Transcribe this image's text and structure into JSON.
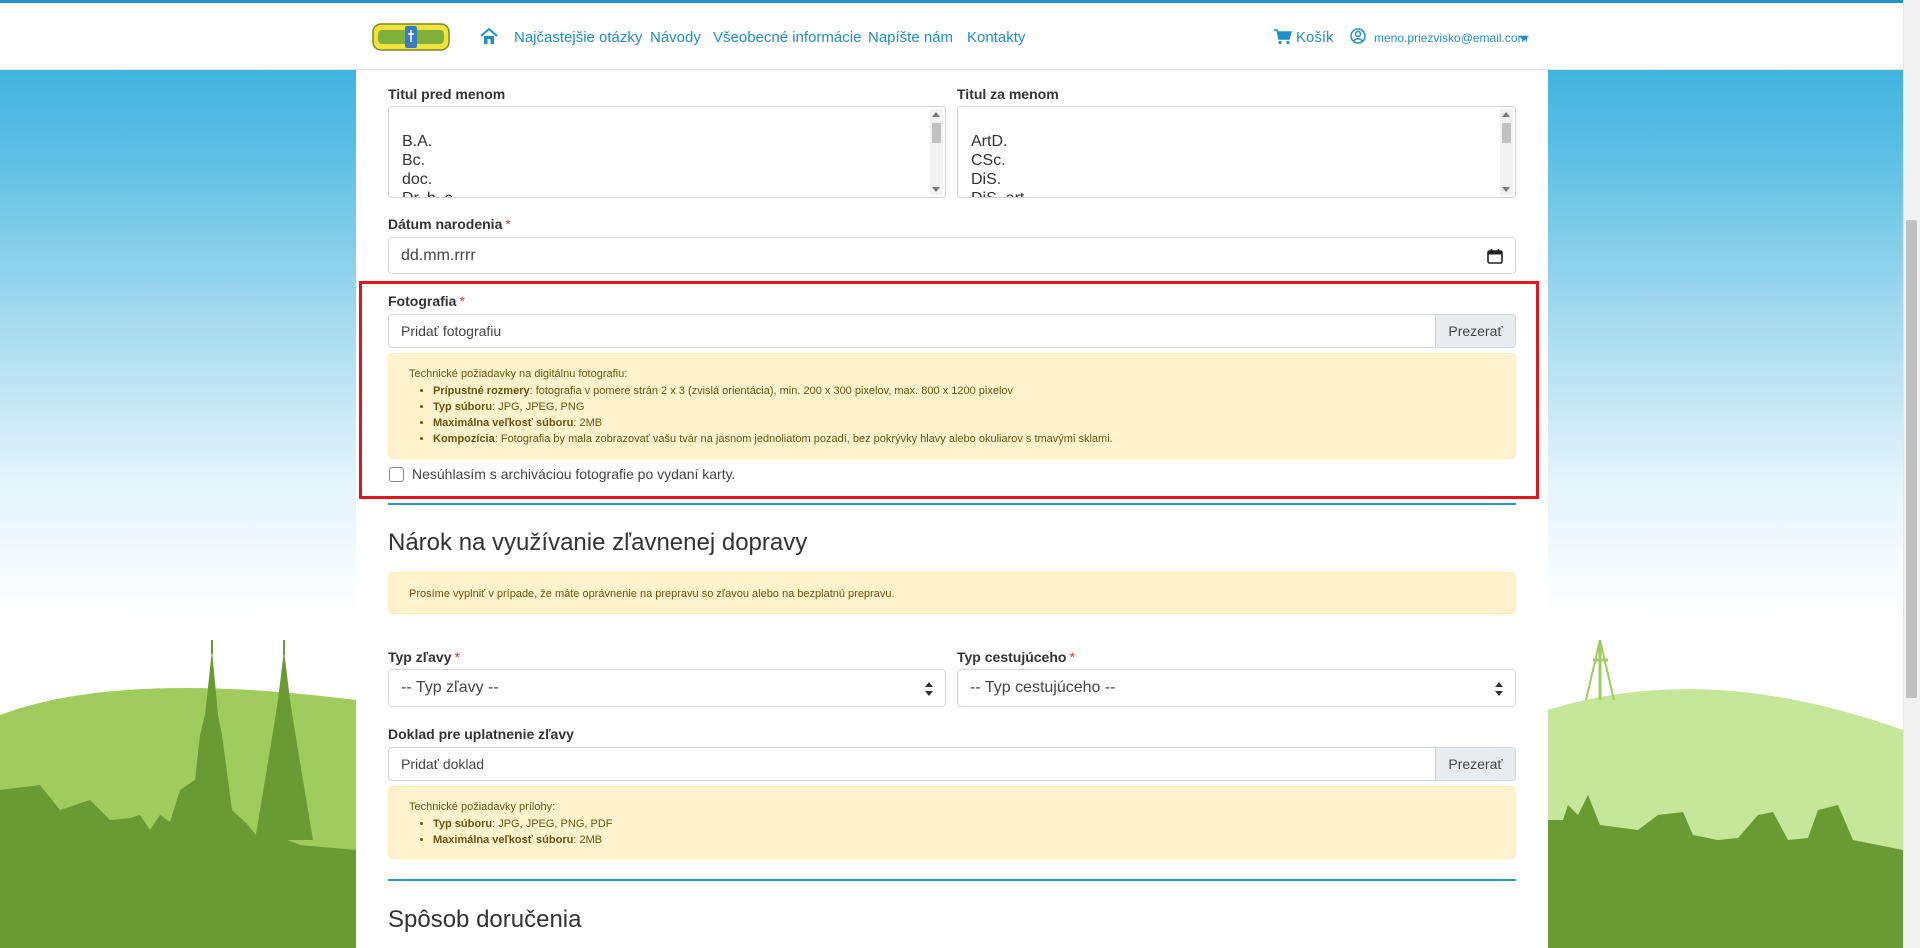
{
  "nav": {
    "links": [
      {
        "label": "Najčastejšie otázky"
      },
      {
        "label": "Návody"
      },
      {
        "label": "Všeobecné informácie"
      },
      {
        "label": "Napíšte nám"
      },
      {
        "label": "Kontakty"
      }
    ],
    "cart_label": "Košík",
    "user_email": "meno.priezvisko@email.com"
  },
  "form": {
    "title_before": {
      "label": "Titul pred menom",
      "options": [
        "B.A.",
        "Bc.",
        "doc.",
        "Dr. h. c."
      ]
    },
    "title_after": {
      "label": "Titul za menom",
      "options": [
        "ArtD.",
        "CSc.",
        "DiS.",
        "DiS. art."
      ]
    },
    "birth_date": {
      "label": "Dátum narodenia",
      "required_mark": "*",
      "placeholder": "dd.mm.rrrr"
    },
    "photo": {
      "label": "Fotografia",
      "required_mark": "*",
      "field_text": "Pridať fotografiu",
      "browse_label": "Prezerať",
      "requirements_head": "Technické požiadavky na digitálnu fotografiu:",
      "requirements": [
        {
          "key": "Prípustné rozmery",
          "value": ": fotografia v pomere strán 2 x 3 (zvislá orientácia), min. 200 x 300 pixelov, max. 800 x 1200 pixelov"
        },
        {
          "key": "Typ súboru",
          "value": ": JPG, JPEG, PNG"
        },
        {
          "key": "Maximálna veľkosť súboru",
          "value": ": 2MB"
        },
        {
          "key": "Kompozícia",
          "value": ": Fotografia by mala zobrazovať vašu tvár na jasnom jednoliatom pozadí, bez pokrývky hlavy alebo okuliarov s tmavými sklami."
        }
      ],
      "consent_label": "Nesúhlasím s archiváciou fotografie po vydaní karty."
    },
    "discount_section": {
      "title": "Nárok na využívanie zľavnenej dopravy",
      "notice": "Prosíme vyplniť v prípade, že máte oprávnenie na prepravu so zľavou alebo na bezplatnú prepravu.",
      "discount_type": {
        "label": "Typ zľavy",
        "required_mark": "*",
        "selected": "-- Typ zľavy --"
      },
      "traveler_type": {
        "label": "Typ cestujúceho",
        "required_mark": "*",
        "selected": "-- Typ cestujúceho --"
      },
      "document": {
        "label": "Doklad pre uplatnenie zľavy",
        "field_text": "Pridať doklad",
        "browse_label": "Prezerať",
        "requirements_head": "Technické požiadavky prílohy:",
        "requirements": [
          {
            "key": "Typ súboru",
            "value": ": JPG, JPEG, PNG, PDF"
          },
          {
            "key": "Maximálna veľkosť súboru",
            "value": ": 2MB"
          }
        ]
      }
    },
    "delivery_section": {
      "title": "Spôsob doručenia"
    }
  },
  "colors": {
    "accent": "#1f8ec9",
    "highlight_box": "#e3141c",
    "alert_bg": "#fff3cd"
  }
}
